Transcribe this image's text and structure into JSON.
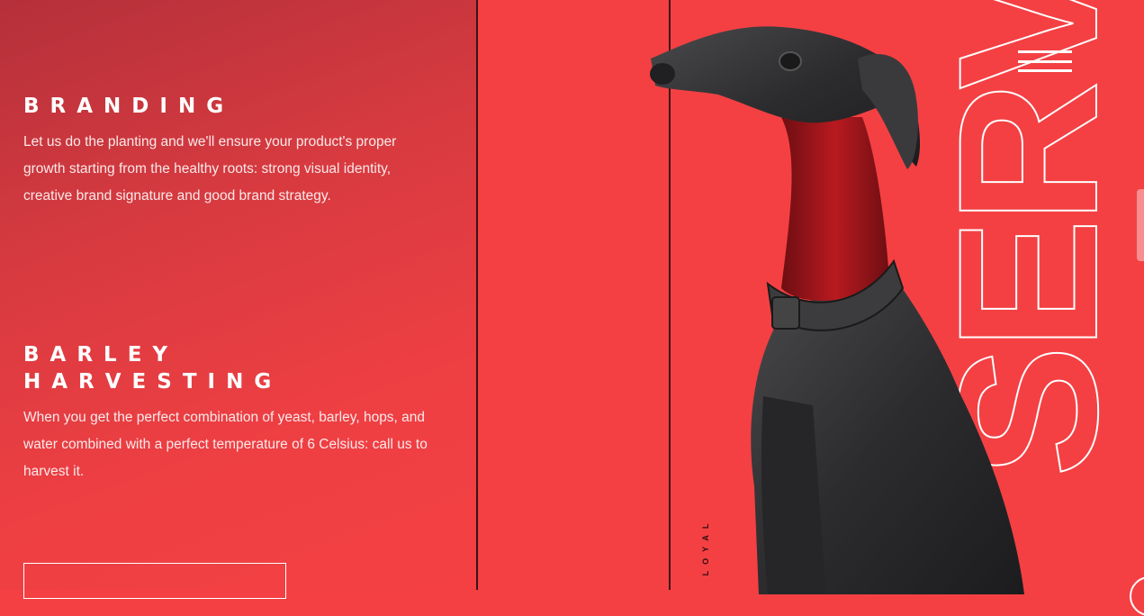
{
  "services": [
    {
      "title": "BRANDING",
      "description": "Let us do the planting and we'll ensure your product's proper growth starting from the healthy roots: strong visual identity, creative brand signature and good brand strategy."
    },
    {
      "title": "BARLEY HARVESTING",
      "description": "When you get the perfect combination of yeast, barley, hops, and water combined with a perfect temperature of 6 Celsius: call us to harvest it."
    }
  ],
  "vertical_tag": "LOYAL",
  "big_word": "SERVICES",
  "menu_icon": "hamburger-menu-icon",
  "colors": {
    "background": "#f44043",
    "gradient_dark": "#b5303a",
    "line": "#3a1416",
    "text": "#ffffff",
    "dog": "#2f2f31",
    "dog_neck": "#a8171c"
  }
}
